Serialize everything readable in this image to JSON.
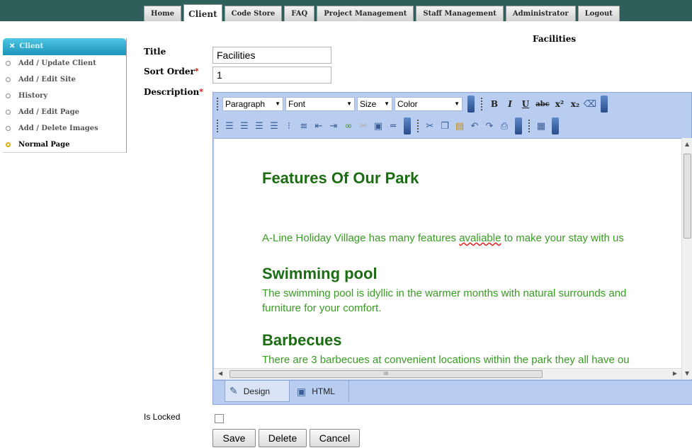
{
  "nav": {
    "tabs": [
      "Home",
      "Client",
      "Code Store",
      "FAQ",
      "Project Management",
      "Staff Management",
      "Administrator",
      "Logout"
    ],
    "active_tab": "Client"
  },
  "sidebar": {
    "header": "Client",
    "items": [
      {
        "label": "Add / Update Client"
      },
      {
        "label": "Add / Edit Site"
      },
      {
        "label": "History"
      },
      {
        "label": "Add / Edit Page"
      },
      {
        "label": "Add / Delete Images"
      },
      {
        "label": "Normal Page",
        "selected": true
      }
    ]
  },
  "page": {
    "heading": "Facilities"
  },
  "form": {
    "title_label": "Title",
    "title_value": "Facilities",
    "sort_label": "Sort Order",
    "sort_value": "1",
    "required_mark": "*",
    "description_label": "Description",
    "locked_label": "Is Locked",
    "locked": false
  },
  "editor": {
    "paragraph_dd": "Paragraph",
    "font_dd": "Font",
    "size_dd": "Size",
    "color_dd": "Color",
    "format_buttons": [
      "B",
      "I",
      "U",
      "abc",
      "x²",
      "x₂"
    ],
    "modes": [
      "Design",
      "HTML"
    ],
    "active_mode": "Design",
    "content": {
      "h1": "Features Of Our Park",
      "intro": "A-Line Holiday Village has many features ",
      "intro_misspelled": "avaliable",
      "intro_rest": " to make your stay with us",
      "pool_heading": "Swimming pool",
      "pool_line1": "The swimming pool is idyllic in the warmer months with natural surrounds and",
      "pool_line2": "furniture for your comfort.",
      "bbq_heading": "Barbecues",
      "bbq_line1": "There are 3 barbecues at convenient locations within the park they all have ou"
    },
    "scroll_label": "III"
  },
  "buttons": {
    "save": "Save",
    "delete": "Delete",
    "cancel": "Cancel"
  },
  "colors": {
    "topbar": "#2f5f5a",
    "heading_green": "#1b6c12",
    "text_green": "#3a9a26",
    "toolbar_blue": "#b8cdf0",
    "required_red": "#d40000"
  }
}
